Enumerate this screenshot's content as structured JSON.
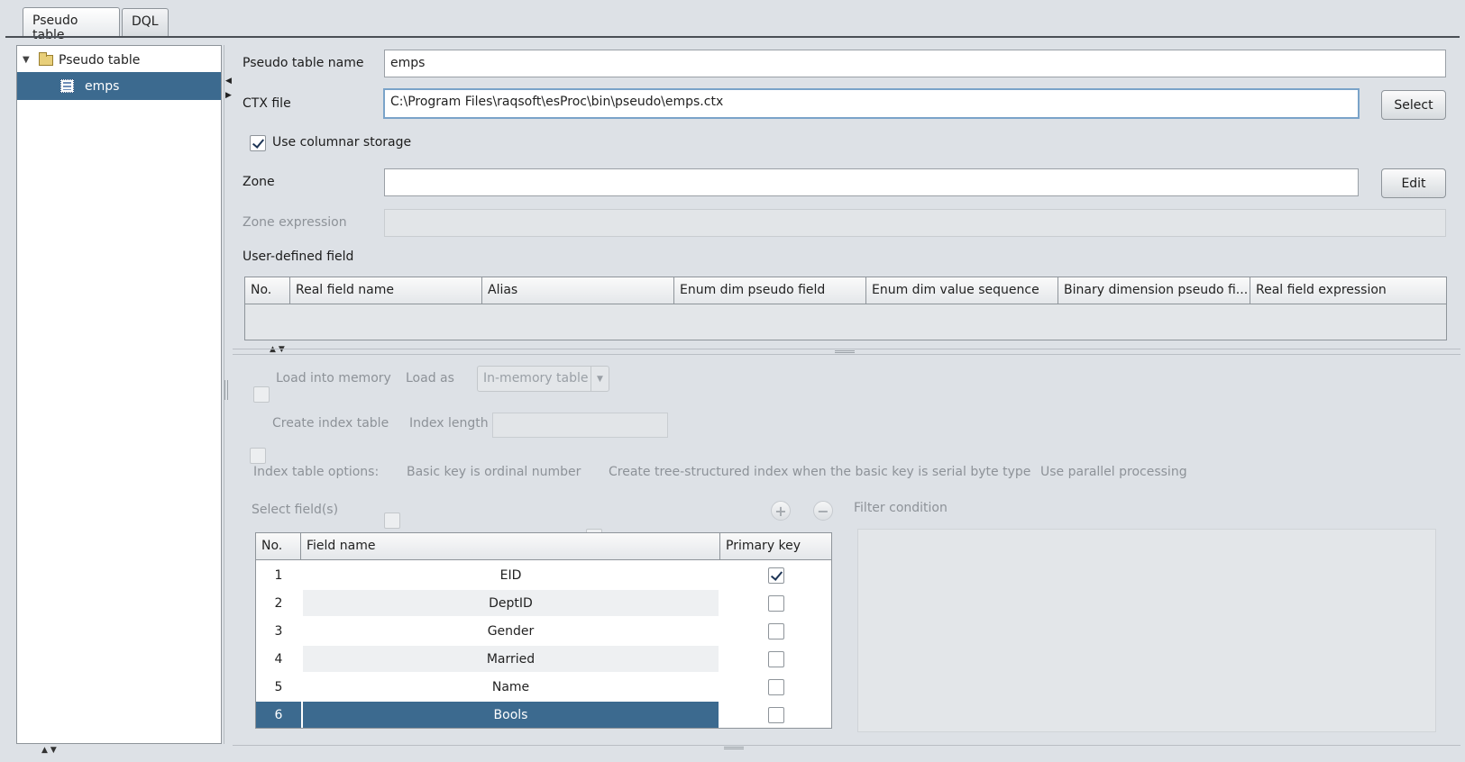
{
  "tabs": [
    {
      "label": "Pseudo table",
      "active": true
    },
    {
      "label": "DQL",
      "active": false
    }
  ],
  "tree": {
    "root_label": "Pseudo table",
    "children": [
      {
        "label": "emps",
        "selected": true
      }
    ]
  },
  "form": {
    "name_label": "Pseudo table name",
    "name_value": "emps",
    "ctx_label": "CTX file",
    "ctx_value": "C:\\Program Files\\raqsoft\\esProc\\bin\\pseudo\\emps.ctx",
    "select_button": "Select",
    "columnar_label": "Use columnar storage",
    "columnar_checked": true,
    "zone_label": "Zone",
    "zone_value": "",
    "edit_button": "Edit",
    "zone_expr_label": "Zone expression",
    "zone_expr_value": "",
    "user_field_label": "User-defined field",
    "user_field_columns": [
      "No.",
      "Real field name",
      "Alias",
      "Enum dim pseudo field",
      "Enum dim value sequence",
      "Binary dimension pseudo fi...",
      "Real field expression"
    ]
  },
  "options": {
    "load_memory_label": "Load into memory",
    "load_as_label": "Load as",
    "load_as_value": "In-memory table",
    "create_index_label": "Create index table",
    "index_length_label": "Index length",
    "index_length_value": "",
    "index_options_label": "Index table options:",
    "basic_key_label": "Basic key is ordinal number",
    "tree_index_label": "Create tree-structured index when the basic key is serial byte type",
    "parallel_label": "Use parallel processing"
  },
  "fields": {
    "select_label": "Select field(s)",
    "filter_label": "Filter condition",
    "filter_value": "",
    "columns": [
      "No.",
      "Field name",
      "Primary key"
    ],
    "rows": [
      {
        "no": "1",
        "name": "EID",
        "primary_key": true,
        "selected": false
      },
      {
        "no": "2",
        "name": "DeptID",
        "primary_key": false,
        "selected": false
      },
      {
        "no": "3",
        "name": "Gender",
        "primary_key": false,
        "selected": false
      },
      {
        "no": "4",
        "name": "Married",
        "primary_key": false,
        "selected": false
      },
      {
        "no": "5",
        "name": "Name",
        "primary_key": false,
        "selected": false
      },
      {
        "no": "6",
        "name": "Bools",
        "primary_key": false,
        "selected": true
      }
    ]
  },
  "colors": {
    "selection": "#3c6a8f",
    "background": "#dde1e6"
  }
}
